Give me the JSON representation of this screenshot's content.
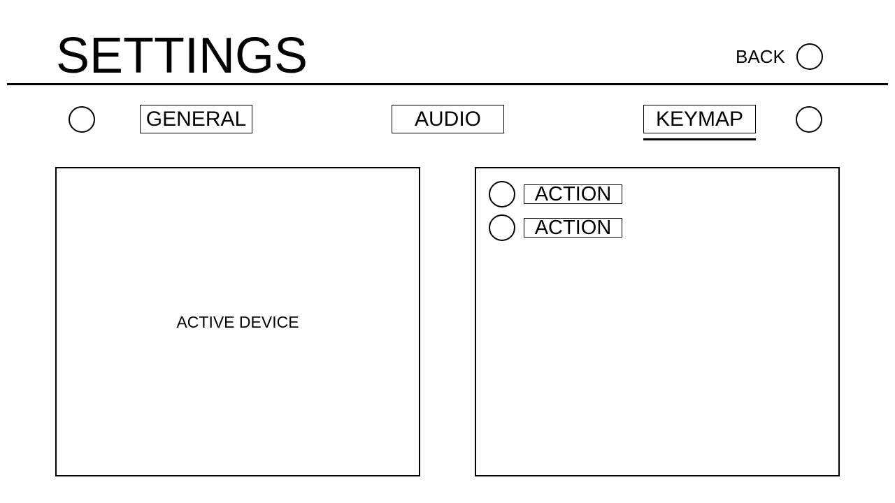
{
  "header": {
    "title": "SETTINGS",
    "back_label": "BACK"
  },
  "tabs": [
    {
      "label": "GENERAL",
      "selected": false
    },
    {
      "label": "AUDIO",
      "selected": false
    },
    {
      "label": "KEYMAP",
      "selected": true
    }
  ],
  "device_panel": {
    "label": "ACTIVE DEVICE"
  },
  "keymap_panel": {
    "actions": [
      {
        "label": "ACTION"
      },
      {
        "label": "ACTION"
      }
    ]
  }
}
